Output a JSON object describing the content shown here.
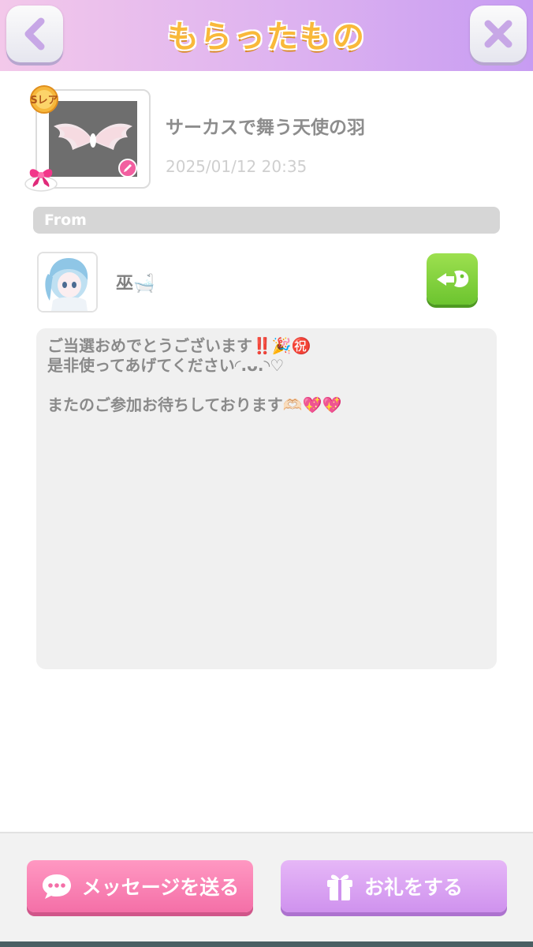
{
  "header": {
    "title": "もらったもの",
    "back_icon": "chevron-left-icon",
    "close_icon": "close-icon"
  },
  "item": {
    "name": "サーカスで舞う天使の羽",
    "date": "2025/01/12 20:35",
    "rarity": "Sレア",
    "thumbnail": "angel-wings-image",
    "category_icon": "pink-ribbon-icon",
    "edit_icon": "pencil-icon"
  },
  "from": {
    "label": "From"
  },
  "sender": {
    "name": "巫🛁",
    "visit_icon": "visit-room-icon"
  },
  "message": {
    "lines": [
      "ご当選おめでとうございます‼️🎉㊗️",
      "是非使ってあげてください◜.ᴗ.◝♡",
      "",
      "またのご参加お待ちしております🫶🏻💖💖"
    ]
  },
  "footer": {
    "message_button": "メッセージを送る",
    "thanks_button": "お礼をする",
    "message_icon": "speech-bubble-icon",
    "thanks_icon": "gift-icon"
  },
  "colors": {
    "header_left": "#f3c8ea",
    "header_right": "#c79cf2",
    "title": "#f9b93a",
    "message_button": "#f46fa7",
    "thanks_button": "#cf92ee",
    "visit_button": "#6cc42f"
  }
}
